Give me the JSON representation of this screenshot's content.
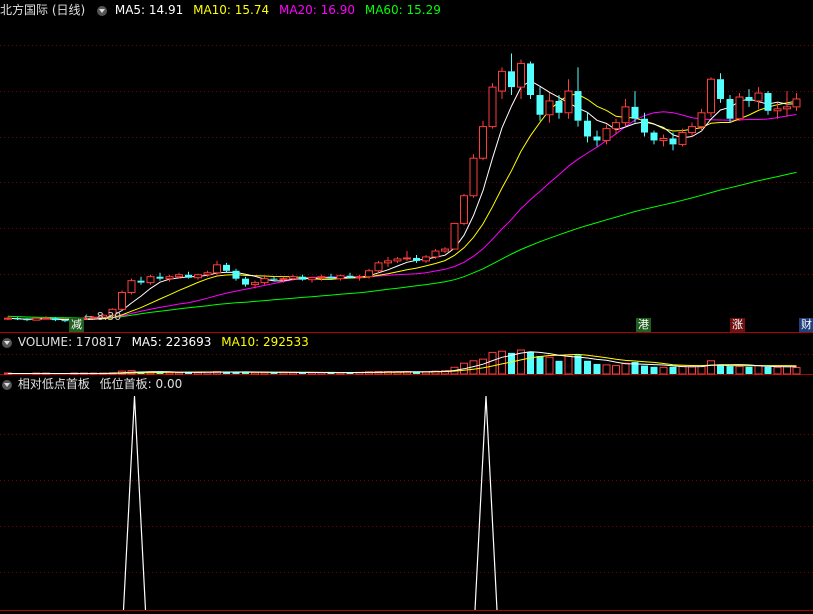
{
  "main_panel": {
    "title": "北方国际 (日线)",
    "ma5_label": "MA5: 14.91",
    "ma10_label": "MA10: 15.74",
    "ma20_label": "MA20: 16.90",
    "ma60_label": "MA60: 15.29",
    "low_price_label": "8.30",
    "badges": [
      "减",
      "港",
      "涨",
      "财"
    ]
  },
  "volume_panel": {
    "title": "VOLUME: 170817",
    "ma5_label": "MA5: 223693",
    "ma10_label": "MA10: 292533"
  },
  "indicator_panel": {
    "name": "相对低点首板",
    "line_label": "低位首板: 0.00"
  },
  "colors": {
    "up": "#ff3c3c",
    "down": "#54ffff",
    "ma5": "#ffffff",
    "ma10": "#ffff00",
    "ma20": "#ff00ff",
    "ma60": "#00ff00",
    "grid": "#7a0000",
    "border": "#b00000"
  },
  "chart_data": {
    "type": "candlestick",
    "candles": [
      [
        8.5,
        8.6,
        8.4,
        8.5
      ],
      [
        8.5,
        8.55,
        8.4,
        8.45
      ],
      [
        8.45,
        8.5,
        8.35,
        8.4
      ],
      [
        8.4,
        8.55,
        8.4,
        8.5
      ],
      [
        8.5,
        8.6,
        8.45,
        8.5
      ],
      [
        8.5,
        8.55,
        8.35,
        8.4
      ],
      [
        8.4,
        8.45,
        8.3,
        8.35
      ],
      [
        8.35,
        8.5,
        8.3,
        8.45
      ],
      [
        8.45,
        8.55,
        8.4,
        8.5
      ],
      [
        8.5,
        8.6,
        8.45,
        8.55
      ],
      [
        8.55,
        8.7,
        8.5,
        8.65
      ],
      [
        8.65,
        9.0,
        8.6,
        8.95
      ],
      [
        8.95,
        9.9,
        8.9,
        9.8
      ],
      [
        9.8,
        10.5,
        9.7,
        10.4
      ],
      [
        10.4,
        10.6,
        10.2,
        10.3
      ],
      [
        10.3,
        10.7,
        10.2,
        10.6
      ],
      [
        10.6,
        10.8,
        10.4,
        10.5
      ],
      [
        10.5,
        10.7,
        10.35,
        10.6
      ],
      [
        10.6,
        10.8,
        10.5,
        10.7
      ],
      [
        10.7,
        10.85,
        10.5,
        10.55
      ],
      [
        10.55,
        10.75,
        10.45,
        10.7
      ],
      [
        10.7,
        10.9,
        10.6,
        10.8
      ],
      [
        10.8,
        11.4,
        10.7,
        11.2
      ],
      [
        11.2,
        11.3,
        10.8,
        10.9
      ],
      [
        10.9,
        11.0,
        10.4,
        10.5
      ],
      [
        10.5,
        10.6,
        10.1,
        10.2
      ],
      [
        10.2,
        10.4,
        10.0,
        10.3
      ],
      [
        10.3,
        10.6,
        10.2,
        10.5
      ],
      [
        10.5,
        10.6,
        10.35,
        10.45
      ],
      [
        10.45,
        10.6,
        10.3,
        10.5
      ],
      [
        10.5,
        10.7,
        10.4,
        10.6
      ],
      [
        10.6,
        10.7,
        10.4,
        10.45
      ],
      [
        10.45,
        10.6,
        10.3,
        10.55
      ],
      [
        10.55,
        10.7,
        10.4,
        10.6
      ],
      [
        10.6,
        10.75,
        10.45,
        10.5
      ],
      [
        10.5,
        10.7,
        10.4,
        10.65
      ],
      [
        10.65,
        10.8,
        10.5,
        10.55
      ],
      [
        10.55,
        10.7,
        10.4,
        10.6
      ],
      [
        10.6,
        11.0,
        10.5,
        10.9
      ],
      [
        10.9,
        11.4,
        10.8,
        11.3
      ],
      [
        11.3,
        11.6,
        11.1,
        11.4
      ],
      [
        11.4,
        11.6,
        11.3,
        11.5
      ],
      [
        11.5,
        11.9,
        11.4,
        11.55
      ],
      [
        11.55,
        11.7,
        11.3,
        11.4
      ],
      [
        11.4,
        11.7,
        11.3,
        11.6
      ],
      [
        11.6,
        12.0,
        11.5,
        11.9
      ],
      [
        11.9,
        12.1,
        11.8,
        12.0
      ],
      [
        12.0,
        13.3,
        12.0,
        13.3
      ],
      [
        13.3,
        14.8,
        13.2,
        14.7
      ],
      [
        14.7,
        16.8,
        14.6,
        16.6
      ],
      [
        16.6,
        18.5,
        16.5,
        18.2
      ],
      [
        18.2,
        20.4,
        18.1,
        20.2
      ],
      [
        20.0,
        21.2,
        19.6,
        21.0
      ],
      [
        21.0,
        21.9,
        19.8,
        20.2
      ],
      [
        20.2,
        21.6,
        19.6,
        21.4
      ],
      [
        21.4,
        21.5,
        19.6,
        19.8
      ],
      [
        19.8,
        20.2,
        18.5,
        18.8
      ],
      [
        18.8,
        19.9,
        18.4,
        19.5
      ],
      [
        19.5,
        19.8,
        18.6,
        18.9
      ],
      [
        18.9,
        20.6,
        18.6,
        20.0
      ],
      [
        20.0,
        21.2,
        18.2,
        18.5
      ],
      [
        18.5,
        18.9,
        17.4,
        17.7
      ],
      [
        17.7,
        18.0,
        17.2,
        17.5
      ],
      [
        17.5,
        18.3,
        17.3,
        18.1
      ],
      [
        18.1,
        18.6,
        17.8,
        18.4
      ],
      [
        18.4,
        19.6,
        18.2,
        19.2
      ],
      [
        19.2,
        20.0,
        18.4,
        18.6
      ],
      [
        18.6,
        18.9,
        17.7,
        17.9
      ],
      [
        17.9,
        18.0,
        17.3,
        17.5
      ],
      [
        17.5,
        17.8,
        17.2,
        17.6
      ],
      [
        17.6,
        17.9,
        17.0,
        17.3
      ],
      [
        17.3,
        18.1,
        17.2,
        17.9
      ],
      [
        17.9,
        18.4,
        17.7,
        18.2
      ],
      [
        18.2,
        19.1,
        18.0,
        18.9
      ],
      [
        18.9,
        20.7,
        18.7,
        20.6
      ],
      [
        20.6,
        20.9,
        19.4,
        19.6
      ],
      [
        19.6,
        19.8,
        18.4,
        18.6
      ],
      [
        18.6,
        19.9,
        18.5,
        19.7
      ],
      [
        19.7,
        20.1,
        19.2,
        19.5
      ],
      [
        19.5,
        20.2,
        19.1,
        19.9
      ],
      [
        19.9,
        20.0,
        18.8,
        19.0
      ],
      [
        19.0,
        19.4,
        18.6,
        19.1
      ],
      [
        19.1,
        20.0,
        18.7,
        19.2
      ],
      [
        19.2,
        19.9,
        19.0,
        19.6
      ]
    ],
    "ma60": [
      8.6,
      8.58,
      8.56,
      8.55,
      8.54,
      8.53,
      8.52,
      8.51,
      8.5,
      8.5,
      8.51,
      8.53,
      8.58,
      8.65,
      8.72,
      8.79,
      8.85,
      8.91,
      8.97,
      9.03,
      9.08,
      9.13,
      9.19,
      9.24,
      9.28,
      9.31,
      9.35,
      9.39,
      9.43,
      9.47,
      9.51,
      9.55,
      9.59,
      9.63,
      9.67,
      9.71,
      9.75,
      9.79,
      9.84,
      9.9,
      9.96,
      10.02,
      10.08,
      10.14,
      10.2,
      10.27,
      10.34,
      10.45,
      10.6,
      10.8,
      11.0,
      11.25,
      11.5,
      11.75,
      11.98,
      12.18,
      12.37,
      12.55,
      12.72,
      12.89,
      13.05,
      13.2,
      13.34,
      13.48,
      13.62,
      13.76,
      13.9,
      14.02,
      14.13,
      14.24,
      14.35,
      14.47,
      14.59,
      14.72,
      14.86,
      14.99,
      15.1,
      15.22,
      15.34,
      15.46,
      15.57,
      15.67,
      15.78,
      15.88
    ],
    "volumes": [
      0.02,
      0.02,
      0.02,
      0.02,
      0.02,
      0.02,
      0.02,
      0.02,
      0.02,
      0.02,
      0.03,
      0.05,
      0.12,
      0.14,
      0.08,
      0.09,
      0.07,
      0.07,
      0.06,
      0.07,
      0.07,
      0.08,
      0.1,
      0.09,
      0.08,
      0.08,
      0.07,
      0.07,
      0.06,
      0.07,
      0.06,
      0.06,
      0.06,
      0.06,
      0.06,
      0.06,
      0.06,
      0.07,
      0.09,
      0.1,
      0.1,
      0.09,
      0.1,
      0.09,
      0.09,
      0.12,
      0.14,
      0.28,
      0.45,
      0.55,
      0.62,
      0.9,
      0.95,
      0.88,
      1.0,
      0.92,
      0.75,
      0.7,
      0.55,
      0.75,
      0.78,
      0.55,
      0.42,
      0.38,
      0.35,
      0.45,
      0.5,
      0.35,
      0.3,
      0.28,
      0.3,
      0.32,
      0.3,
      0.35,
      0.55,
      0.4,
      0.33,
      0.32,
      0.3,
      0.35,
      0.3,
      0.28,
      0.3,
      0.27
    ],
    "indicator_spikes_at": [
      11,
      48
    ],
    "ylim": [
      7.8,
      23.7
    ]
  }
}
